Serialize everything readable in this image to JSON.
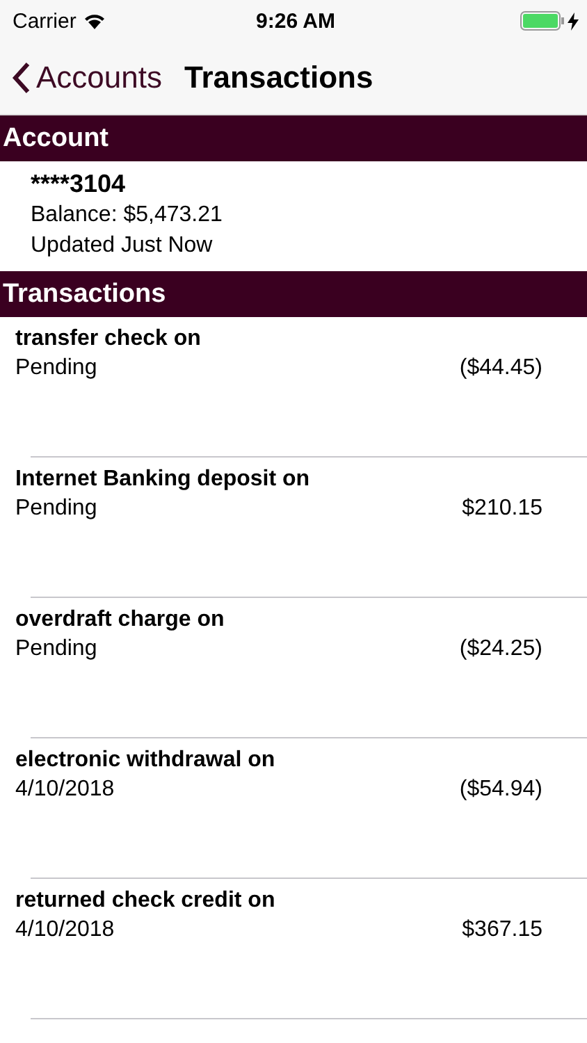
{
  "status_bar": {
    "carrier": "Carrier",
    "time": "9:26 AM"
  },
  "nav": {
    "back": "Accounts",
    "title": "Transactions"
  },
  "account_section": {
    "header": "Account",
    "number": "****3104",
    "balance": "Balance: $5,473.21",
    "updated": "Updated Just Now"
  },
  "transactions_section": {
    "header": "Transactions",
    "rows": [
      {
        "description": "transfer check on",
        "date": "Pending",
        "amount": "($44.45)"
      },
      {
        "description": "Internet Banking deposit on",
        "date": "Pending",
        "amount": "$210.15"
      },
      {
        "description": "overdraft charge on",
        "date": "Pending",
        "amount": "($24.25)"
      },
      {
        "description": "electronic withdrawal on",
        "date": "4/10/2018",
        "amount": "($54.94)"
      },
      {
        "description": "returned check credit on",
        "date": "4/10/2018",
        "amount": "$367.15"
      }
    ]
  }
}
